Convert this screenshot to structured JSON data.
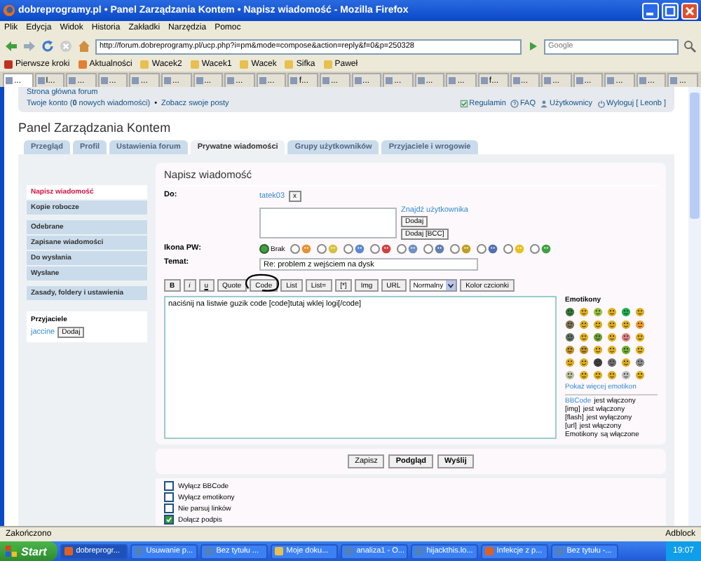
{
  "window": {
    "title": "dobreprogramy.pl • Panel Zarządzania Kontem • Napisz wiadomość - Mozilla Firefox"
  },
  "menu": [
    "Plik",
    "Edycja",
    "Widok",
    "Historia",
    "Zakładki",
    "Narzędzia",
    "Pomoc"
  ],
  "address": {
    "url": "http://forum.dobreprogramy.pl/ucp.php?i=pm&mode=compose&action=reply&f=0&p=250328"
  },
  "search": {
    "placeholder": "Google"
  },
  "bookmarks": [
    {
      "label": "Pierwsze kroki",
      "kind": "page"
    },
    {
      "label": "Aktualności",
      "kind": "feed"
    },
    {
      "label": "Wacek2",
      "kind": "folder"
    },
    {
      "label": "Wacek1",
      "kind": "folder"
    },
    {
      "label": "Wacek",
      "kind": "folder"
    },
    {
      "label": "Sifka",
      "kind": "folder"
    },
    {
      "label": "Paweł",
      "kind": "folder"
    }
  ],
  "browser_tabs": [
    {
      "label": "...",
      "selected": true
    },
    {
      "label": "I...",
      "selected": false
    },
    {
      "label": "...",
      "selected": false
    },
    {
      "label": "...",
      "selected": false
    },
    {
      "label": "...",
      "selected": false
    },
    {
      "label": "...",
      "selected": false
    },
    {
      "label": "...",
      "selected": false
    },
    {
      "label": "...",
      "selected": false
    },
    {
      "label": "...",
      "selected": false
    },
    {
      "label": "f...",
      "selected": false
    },
    {
      "label": "...",
      "selected": false
    },
    {
      "label": "...",
      "selected": false
    },
    {
      "label": "...",
      "selected": false
    },
    {
      "label": "...",
      "selected": false
    },
    {
      "label": "...",
      "selected": false
    },
    {
      "label": "f...",
      "selected": false
    },
    {
      "label": "...",
      "selected": false
    },
    {
      "label": "...",
      "selected": false
    },
    {
      "label": "...",
      "selected": false
    },
    {
      "label": "...",
      "selected": false
    },
    {
      "label": "...",
      "selected": false
    },
    {
      "label": "...",
      "selected": false
    }
  ],
  "forum_header": {
    "home_link": "Strona główna forum",
    "account_link": "Twoje konto (**0** nowych wiadomości)",
    "separator": "•",
    "posts_link": "Zobacz swoje posty",
    "links": [
      {
        "label": "Regulamin",
        "kind": "rules"
      },
      {
        "label": "FAQ",
        "kind": "faq"
      },
      {
        "label": "Użytkownicy",
        "kind": "users"
      },
      {
        "label": "Wyloguj [ Leonb ]",
        "kind": "logout"
      }
    ]
  },
  "panel_title": "Panel Zarządzania Kontem",
  "panel_tabs": [
    {
      "label": "Przegląd",
      "selected": false
    },
    {
      "label": "Profil",
      "selected": false
    },
    {
      "label": "Ustawienia forum",
      "selected": false
    },
    {
      "label": "Prywatne wiadomości",
      "selected": true
    },
    {
      "label": "Grupy użytkowników",
      "selected": false
    },
    {
      "label": "Przyjaciele i wrogowie",
      "selected": false
    }
  ],
  "side_menu": [
    {
      "items": [
        {
          "label": "Napisz wiadomość",
          "selected": true
        },
        {
          "label": "Kopie robocze",
          "selected": false
        }
      ]
    },
    {
      "items": [
        {
          "label": "Odebrane",
          "selected": false
        },
        {
          "label": "Zapisane wiadomości",
          "selected": false
        },
        {
          "label": "Do wysłania",
          "selected": false
        },
        {
          "label": "Wysłane",
          "selected": false
        }
      ]
    },
    {
      "items": [
        {
          "label": "Zasady, foldery i ustawienia",
          "selected": false
        }
      ]
    }
  ],
  "friends": {
    "title": "Przyjaciele",
    "name": "jaccine",
    "button": "Dodaj"
  },
  "compose": {
    "heading": "Napisz wiadomość",
    "to_label": "Do:",
    "recipient": "tatek03",
    "remove": "x",
    "find_user": "Znajdź użytkownika",
    "add_button": "Dodaj",
    "add_bcc_button": "Dodaj [BCC]",
    "icon_label": "Ikona PW:",
    "icons": [
      {
        "kind": "none",
        "label": "Brak",
        "selected": true
      },
      {
        "kind": "bulb",
        "selected": false
      },
      {
        "kind": "star",
        "selected": false
      },
      {
        "kind": "face",
        "selected": false
      },
      {
        "kind": "heart",
        "selected": false
      },
      {
        "kind": "speech",
        "selected": false
      },
      {
        "kind": "question",
        "selected": false
      },
      {
        "kind": "warning",
        "selected": false
      },
      {
        "kind": "info",
        "selected": false
      },
      {
        "kind": "smile",
        "selected": false
      },
      {
        "kind": "alien",
        "selected": false
      }
    ],
    "subject_label": "Temat:",
    "subject": "Re: problem z wejściem na dysk",
    "toolbar": [
      {
        "label": "B",
        "kind": "bold"
      },
      {
        "label": "i",
        "kind": "italic"
      },
      {
        "label": "u",
        "kind": "underline"
      },
      {
        "label": "Quote",
        "kind": "button"
      },
      {
        "label": "Code",
        "kind": "button"
      },
      {
        "label": "List",
        "kind": "button"
      },
      {
        "label": "List=",
        "kind": "button"
      },
      {
        "label": "[*]",
        "kind": "button"
      },
      {
        "label": "Img",
        "kind": "button"
      },
      {
        "label": "URL",
        "kind": "button"
      },
      {
        "label": "Normalny",
        "kind": "select"
      },
      {
        "label": "Kolor czcionki",
        "kind": "button"
      }
    ],
    "message": "naciśnij na listwie guzik code [code]tutaj wklej logi[/code]",
    "buttons": [
      {
        "label": "Zapisz",
        "kind": "plain"
      },
      {
        "label": "Podgląd",
        "kind": "bold"
      },
      {
        "label": "Wyślij",
        "kind": "bold"
      }
    ]
  },
  "emoticons": {
    "title": "Emotikony",
    "more_link": "Pokaż więcej emotikon",
    "status": [
      {
        "lead": "BBCode",
        "text": "jest włączony",
        "kind": "link"
      },
      {
        "lead": "[img]",
        "text": "jest włączony",
        "kind": "plain"
      },
      {
        "lead": "[flash]",
        "text": "jest wyłączony",
        "kind": "plain"
      },
      {
        "lead": "[url]",
        "text": "jest włączony",
        "kind": "plain"
      },
      {
        "lead": "Emotikony",
        "text": "są włączone",
        "kind": "plain"
      }
    ]
  },
  "options": [
    {
      "label": "Wyłącz BBCode",
      "checked": false
    },
    {
      "label": "Wyłącz emotikony",
      "checked": false
    },
    {
      "label": "Nie parsuj linków",
      "checked": false
    },
    {
      "label": "Dołącz podpis",
      "checked": true
    }
  ],
  "status_bar": {
    "text": "Zakończono",
    "addon": "Adblock"
  },
  "taskbar": {
    "start": "Start",
    "clock": "19:07",
    "items": [
      {
        "label": "dobreprogr...",
        "kind": "browser",
        "selected": true
      },
      {
        "label": "Usuwanie p...",
        "kind": "doc",
        "selected": false
      },
      {
        "label": "Bez tytułu ...",
        "kind": "doc",
        "selected": false
      },
      {
        "label": "Moje doku...",
        "kind": "folder",
        "selected": false
      },
      {
        "label": "analiza1 - O...",
        "kind": "doc",
        "selected": false
      },
      {
        "label": "hijackthis.lo...",
        "kind": "doc",
        "selected": false
      },
      {
        "label": "Infekcje z p...",
        "kind": "browser",
        "selected": false
      },
      {
        "label": "Bez tytułu -...",
        "kind": "doc",
        "selected": false
      }
    ]
  }
}
